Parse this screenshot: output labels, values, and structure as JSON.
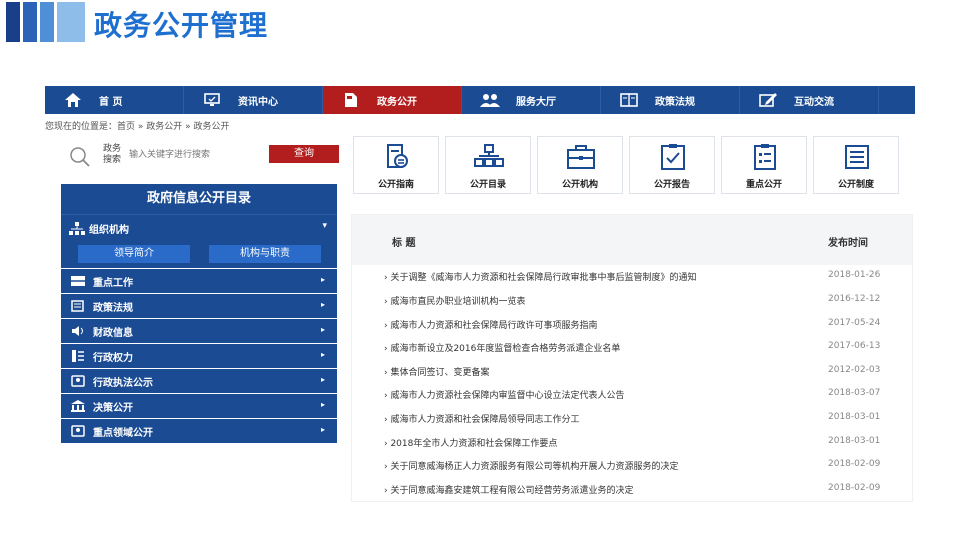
{
  "slide": {
    "title": "政务公开管理"
  },
  "nav": [
    {
      "label": "首 页",
      "icon": "home-icon",
      "active": false
    },
    {
      "label": "资讯中心",
      "icon": "monitor-icon",
      "active": false
    },
    {
      "label": "政务公开",
      "icon": "document-icon",
      "active": true
    },
    {
      "label": "服务大厅",
      "icon": "users-icon",
      "active": false
    },
    {
      "label": "政策法规",
      "icon": "book-icon",
      "active": false
    },
    {
      "label": "互动交流",
      "icon": "edit-icon",
      "active": false
    }
  ],
  "breadcrumb": "您现在的位置是：首页 » 政务公开 » 政务公开",
  "search": {
    "label": "政务搜索",
    "placeholder": "输入关键字进行搜索",
    "button": "查询"
  },
  "directory": {
    "title": "政府信息公开目录",
    "org": {
      "label": "组织机构",
      "buttons": [
        "领导简介",
        "机构与职责"
      ]
    },
    "items": [
      {
        "label": "重点工作",
        "icon": "grid-icon"
      },
      {
        "label": "政策法规",
        "icon": "book-icon"
      },
      {
        "label": "财政信息",
        "icon": "speaker-icon"
      },
      {
        "label": "行政权力",
        "icon": "list-icon"
      },
      {
        "label": "行政执法公示",
        "icon": "badge-icon"
      },
      {
        "label": "决策公开",
        "icon": "bank-icon"
      },
      {
        "label": "重点领域公开",
        "icon": "badge-icon"
      }
    ]
  },
  "tiles": [
    {
      "label": "公开指南",
      "icon": "guide-icon"
    },
    {
      "label": "公开目录",
      "icon": "org-chart-icon"
    },
    {
      "label": "公开机构",
      "icon": "briefcase-icon"
    },
    {
      "label": "公开报告",
      "icon": "clipboard-check-icon"
    },
    {
      "label": "重点公开",
      "icon": "clipboard-list-icon"
    },
    {
      "label": "公开制度",
      "icon": "document-lines-icon"
    }
  ],
  "news": {
    "col_title": "标 题",
    "col_date": "发布时间",
    "rows": [
      {
        "title": "关于调整《威海市人力资源和社会保障局行政审批事中事后监管制度》的通知",
        "date": "2018-01-26"
      },
      {
        "title": "威海市直民办职业培训机构一览表",
        "date": "2016-12-12"
      },
      {
        "title": "威海市人力资源和社会保障局行政许可事项服务指南",
        "date": "2017-05-24"
      },
      {
        "title": "威海市新设立及2016年度监督检查合格劳务派遣企业名单",
        "date": "2017-06-13"
      },
      {
        "title": "集体合同签订、变更备案",
        "date": "2012-02-03"
      },
      {
        "title": "威海市人力资源社会保障内审监督中心设立法定代表人公告",
        "date": "2018-03-07"
      },
      {
        "title": "威海市人力资源和社会保障局领导同志工作分工",
        "date": "2018-03-01"
      },
      {
        "title": "2018年全市人力资源和社会保障工作要点",
        "date": "2018-03-01"
      },
      {
        "title": "关于同意威海杨正人力资源服务有限公司等机构开展人力资源服务的决定",
        "date": "2018-02-09"
      },
      {
        "title": "关于同意威海鑫安建筑工程有限公司经营劳务派遣业务的决定",
        "date": "2018-02-09"
      }
    ]
  }
}
